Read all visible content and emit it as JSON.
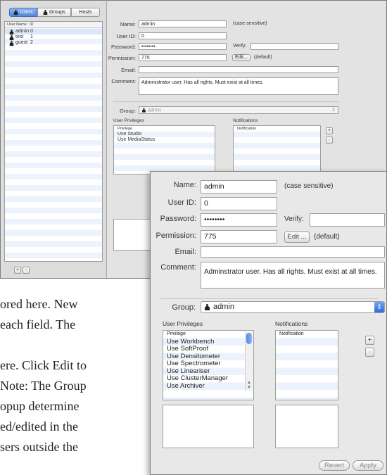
{
  "document": {
    "lines": [
      "ored here. New",
      "each field. The",
      "ere. Click Edit to",
      "Note: The Group",
      "opup determine",
      "ed/edited in the",
      "sers outside the"
    ]
  },
  "back_window": {
    "tabs": [
      "Users",
      "Groups",
      "Hosts"
    ],
    "list_headers": {
      "name": "User Name",
      "id": "ID"
    },
    "users": [
      {
        "name": "admin",
        "id": "0"
      },
      {
        "name": "test",
        "id": "1"
      },
      {
        "name": "guest",
        "id": "2"
      }
    ],
    "labels": {
      "name": "Name:",
      "user_id": "User ID:",
      "password": "Password:",
      "verify": "Verify:",
      "permission": "Permission:",
      "email": "Email:",
      "comment": "Comment:",
      "group": "Group:",
      "user_privileges": "User Privileges",
      "notifications": "Notifications"
    },
    "values": {
      "name": "admin",
      "name_hint": "(case sensitive)",
      "user_id": "0",
      "password": "••••••••",
      "permission": "775",
      "edit_button": "Edit...",
      "permission_hint": "(default)",
      "comment": "Administrator user.  Has all rights.  Must exist at all times.",
      "group": "admin"
    },
    "privileges_header": "Privilege",
    "privileges": [
      "Use Studio",
      "Use MediaStatus"
    ],
    "notifications_header": "Notification",
    "add_label": "+",
    "remove_label": "-"
  },
  "front_window": {
    "labels": {
      "name": "Name:",
      "user_id": "User ID:",
      "password": "Password:",
      "verify": "Verify:",
      "permission": "Permission:",
      "email": "Email:",
      "comment": "Comment:",
      "group": "Group:",
      "user_privileges": "User Privileges",
      "notifications": "Notifications"
    },
    "values": {
      "name": "admin",
      "name_hint": "(case sensitive)",
      "user_id": "0",
      "password": "••••••••",
      "verify": "",
      "permission": "775",
      "edit_button": "Edit ...",
      "permission_hint": "(default)",
      "email": "",
      "comment": "Adminstrator user.  Has all rights.  Must exist at all times.",
      "group": "admin"
    },
    "privileges_header": "Privilege",
    "privileges": [
      "Use Workbench",
      "Use SoftProof",
      "Use Densitometer",
      "Use Spectrometer",
      "Use Lineariser",
      "Use ClusterManager",
      "Use Archiver"
    ],
    "notifications_header": "Notification",
    "add_label": "+",
    "remove_label": "-",
    "revert_button": "Revert",
    "apply_button": "Apply",
    "accent_color": "#3d7fe0"
  }
}
